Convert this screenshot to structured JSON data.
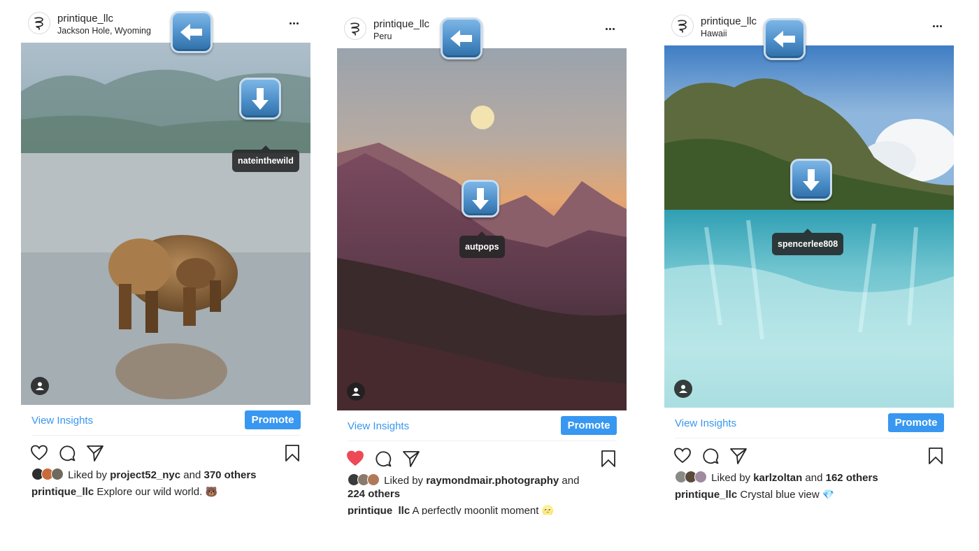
{
  "posts": [
    {
      "username": "printique_llc",
      "location": "Jackson Hole, Wyoming",
      "tag_username": "nateinthewild",
      "view_insights": "View Insights",
      "promote": "Promote",
      "liked_prefix": "Liked by",
      "liked_user": "project52_nyc",
      "liked_and": "and",
      "liked_others": "370 others",
      "caption_user": "printique_llc",
      "caption_text": "Explore our wild world.",
      "caption_emoji": "🐻",
      "liked": false
    },
    {
      "username": "printique_llc",
      "location": "Peru",
      "tag_username": "autpops",
      "view_insights": "View Insights",
      "promote": "Promote",
      "liked_prefix": "Liked by",
      "liked_user": "raymondmair.photography",
      "liked_and": "and",
      "liked_others": "224 others",
      "caption_user": "printique_llc",
      "caption_text": "A perfectly moonlit moment",
      "caption_emoji": "🌝",
      "liked": true
    },
    {
      "username": "printique_llc",
      "location": "Hawaii",
      "tag_username": "spencerlee808",
      "view_insights": "View Insights",
      "promote": "Promote",
      "liked_prefix": "Liked by",
      "liked_user": "karlzoltan",
      "liked_and": "and",
      "liked_others": "162 others",
      "caption_user": "printique_llc",
      "caption_text": "Crystal blue view",
      "caption_emoji": "💎",
      "liked": false
    }
  ],
  "icons": {
    "back_arrow": "left-arrow-key-icon",
    "download_arrow": "down-arrow-key-icon",
    "more": "more-options-icon",
    "like": "heart-icon",
    "comment": "comment-icon",
    "share": "send-icon",
    "save": "bookmark-icon"
  },
  "colors": {
    "accent": "#3897f0",
    "like_red": "#ed4956",
    "text": "#262626"
  }
}
